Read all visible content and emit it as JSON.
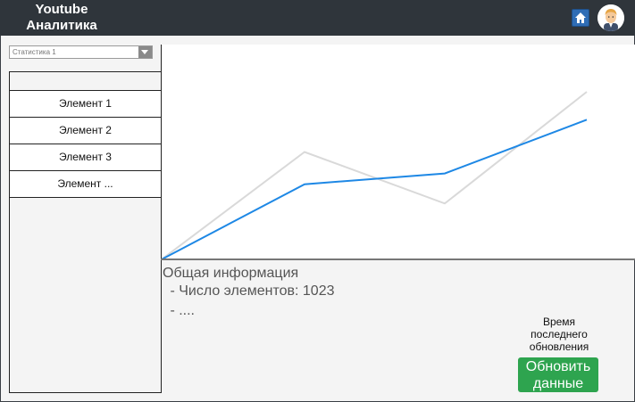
{
  "header": {
    "title": "Youtube\nАналитика",
    "home_icon": "home-icon",
    "avatar_icon": "user-avatar"
  },
  "sidebar": {
    "dropdown_value": "Статистика 1",
    "items": [
      {
        "label": "Элемент 1"
      },
      {
        "label": "Элемент 2"
      },
      {
        "label": "Элемент 3"
      },
      {
        "label": "Элемент ..."
      }
    ]
  },
  "chart_data": {
    "type": "line",
    "x": [
      0,
      1,
      2,
      3
    ],
    "series": [
      {
        "values": [
          0,
          35,
          40,
          65
        ],
        "color": "#1e88e5"
      },
      {
        "values": [
          0,
          50,
          26,
          78
        ],
        "color": "#d9d9d9"
      }
    ],
    "ylim": [
      0,
      100
    ],
    "grid": false
  },
  "info": {
    "title": "Общая информация",
    "line1": " - Число элементов: 1023",
    "line2": " - ...."
  },
  "update": {
    "label": "Время последнего обновления",
    "button_label": "Обновить данные"
  },
  "colors": {
    "header_bg": "#2f353b",
    "accent_green": "#2ea44f",
    "line_primary": "#1e88e5"
  }
}
